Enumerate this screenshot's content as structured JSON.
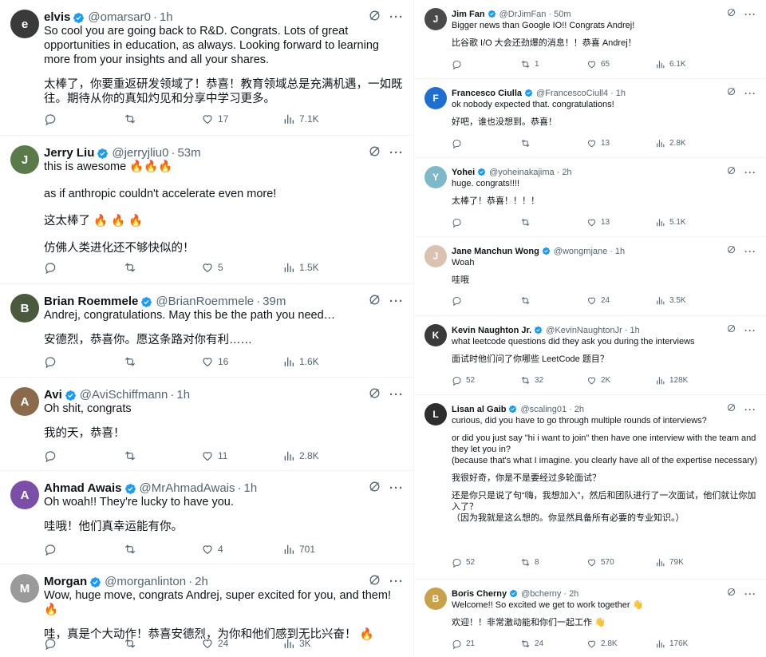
{
  "colors": {
    "verified": "#1d9bf0",
    "text": "#0f1419",
    "secondary": "#536471",
    "border": "#eff3f4"
  },
  "icons": {
    "verified": "verified-badge-icon",
    "grok": "grok-icon",
    "more": "more-icon",
    "reply": "reply-icon",
    "retweet": "retweet-icon",
    "like": "like-icon",
    "views": "views-icon",
    "bookmark": "bookmark-icon",
    "share": "share-icon"
  },
  "left_column": [
    {
      "name": "elvis",
      "handle": "@omarsar0",
      "time": "1h",
      "avatar_color": "#3a3a3a",
      "avatar_initial": "e",
      "paragraphs": [
        "So cool you are going back to R&D. Congrats. Lots of great opportunities in education, as always. Looking forward to learning more from your insights and all your shares.",
        "太棒了，你要重返研发领域了！恭喜！教育领域总是充满机遇，一如既往。期待从你的真知灼见和分享中学习更多。"
      ],
      "replies": "",
      "retweets": "",
      "likes": "17",
      "views": "7.1K"
    },
    {
      "name": "Jerry Liu",
      "handle": "@jerryjliu0",
      "time": "53m",
      "avatar_color": "#5a7a4a",
      "avatar_initial": "J",
      "paragraphs": [
        "this is awesome 🔥🔥🔥",
        "as if anthropic couldn't accelerate even more!",
        "这太棒了 🔥 🔥 🔥",
        "仿佛人类进化还不够快似的！"
      ],
      "replies": "",
      "retweets": "",
      "likes": "5",
      "views": "1.5K"
    },
    {
      "name": "Brian Roemmele",
      "handle": "@BrianRoemmele",
      "time": "39m",
      "avatar_color": "#4b5a3c",
      "avatar_initial": "B",
      "paragraphs": [
        "Andrej, congratulations. May this be the path you need…",
        "安德烈，恭喜你。愿这条路对你有利……"
      ],
      "replies": "",
      "retweets": "",
      "likes": "16",
      "views": "1.6K"
    },
    {
      "name": "Avi",
      "handle": "@AviSchiffmann",
      "time": "1h",
      "avatar_color": "#8a6a4a",
      "avatar_initial": "A",
      "paragraphs": [
        "Oh shit, congrats",
        "我的天，恭喜！"
      ],
      "replies": "",
      "retweets": "",
      "likes": "11",
      "views": "2.8K"
    },
    {
      "name": "Ahmad Awais",
      "handle": "@MrAhmadAwais",
      "time": "1h",
      "avatar_color": "#7b4fa8",
      "avatar_initial": "A",
      "paragraphs": [
        "Oh woah!! They're lucky to have you.",
        "哇哦！他们真幸运能有你。"
      ],
      "replies": "",
      "retweets": "",
      "likes": "4",
      "views": "701"
    },
    {
      "name": "Morgan",
      "handle": "@morganlinton",
      "time": "2h",
      "avatar_color": "#9a9a9a",
      "avatar_initial": "M",
      "paragraphs": [
        "Wow, huge move, congrats Andrej, super excited for you, and them! 🔥",
        "哇，真是个大动作！恭喜安德烈，为你和他们感到无比兴奋！ 🔥"
      ],
      "replies": "",
      "retweets": "",
      "likes": "24",
      "views": "3K"
    }
  ],
  "right_column": [
    {
      "name": "Jim Fan",
      "handle": "@DrJimFan",
      "time": "50m",
      "avatar_color": "#4a4a4a",
      "avatar_initial": "J",
      "paragraphs": [
        "Bigger news than Google IO!! Congrats Andrej!",
        "比谷歌 I/O 大会还劲爆的消息！！恭喜 Andrej！"
      ],
      "replies": "",
      "retweets": "1",
      "likes": "65",
      "views": "6.1K"
    },
    {
      "name": "Francesco Ciulla",
      "handle": "@FrancescoCiull4",
      "time": "1h",
      "avatar_color": "#1f6fd1",
      "avatar_initial": "F",
      "paragraphs": [
        "ok nobody expected that. congratulations!",
        "好吧，谁也没想到。恭喜！"
      ],
      "replies": "",
      "retweets": "",
      "likes": "13",
      "views": "2.8K"
    },
    {
      "name": "Yohei",
      "handle": "@yoheinakajima",
      "time": "2h",
      "avatar_color": "#7fb9c9",
      "avatar_initial": "Y",
      "paragraphs": [
        "huge. congrats!!!!",
        "太棒了！恭喜！！！！"
      ],
      "replies": "",
      "retweets": "",
      "likes": "13",
      "views": "5.1K"
    },
    {
      "name": "Jane Manchun Wong",
      "handle": "@wongmjane",
      "time": "1h",
      "avatar_color": "#d9c2b0",
      "avatar_initial": "J",
      "paragraphs": [
        "Woah",
        "哇哦"
      ],
      "replies": "",
      "retweets": "",
      "likes": "24",
      "views": "3.5K"
    },
    {
      "name": "Kevin Naughton Jr.",
      "handle": "@KevinNaughtonJr",
      "time": "1h",
      "avatar_color": "#3a3a3a",
      "avatar_initial": "K",
      "paragraphs": [
        "what leetcode questions did they ask you during the interviews",
        "面试时他们问了你哪些 LeetCode 题目？"
      ],
      "replies": "52",
      "retweets": "32",
      "likes": "2K",
      "views": "128K"
    },
    {
      "name": "Lisan al Gaib",
      "handle": "@scaling01",
      "time": "2h",
      "avatar_color": "#2e2e2e",
      "avatar_initial": "L",
      "paragraphs": [
        "curious, did you have to go through multiple rounds of interviews?",
        "or did you just say \"hi i want to join\" then have one interview with the team and they let you in?\n(because that's what I imagine. you clearly have all of the expertise necessary)",
        "我很好奇，你是不是要经过多轮面试？",
        "还是你只是说了句“嗨，我想加入”，然后和团队进行了一次面试，他们就让你加入了？\n（因为我就是这么想的。你显然具备所有必要的专业知识。）"
      ],
      "replies": "52",
      "retweets": "8",
      "likes": "570",
      "views": "79K"
    },
    {
      "name": "Boris Cherny",
      "handle": "@bcherny",
      "time": "2h",
      "avatar_color": "#c9a14a",
      "avatar_initial": "B",
      "paragraphs": [
        "Welcome!! So excited we get to work together 👋",
        "欢迎！！非常激动能和你们一起工作 👋"
      ],
      "replies": "21",
      "retweets": "24",
      "likes": "2.8K",
      "views": "176K"
    }
  ]
}
